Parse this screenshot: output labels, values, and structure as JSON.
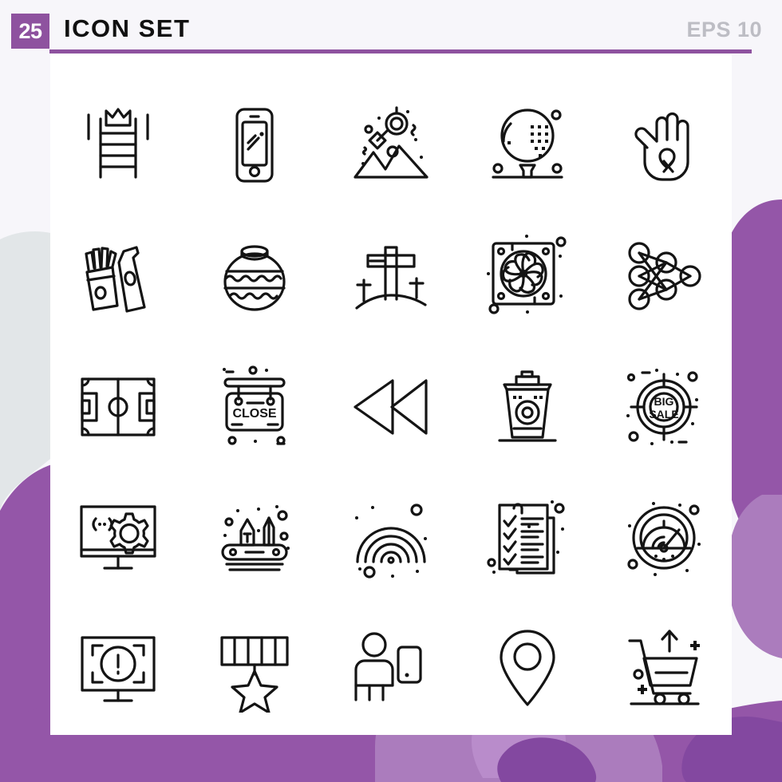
{
  "header": {
    "count_badge": "25",
    "title": "ICON SET",
    "format_label": "EPS 10"
  },
  "colors": {
    "accent_purple": "#8e529f",
    "blob_purple": "#9456a8",
    "blob_purple_light": "#ab7cbd",
    "blob_gray": "#e2e6e8",
    "page_background": "#f7f6fa",
    "card_background": "#ffffff",
    "icon_stroke": "#141414",
    "eps_text": "#bdbdc4"
  },
  "grid": {
    "columns": 5,
    "rows": 5,
    "total": 25
  },
  "icons": [
    {
      "index": 1,
      "name": "ladder-crown-icon",
      "label": "Ladder with crown"
    },
    {
      "index": 2,
      "name": "smartphone-icon",
      "label": "Smartphone"
    },
    {
      "index": 3,
      "name": "satellite-mountains-icon",
      "label": "Satellite over mountains"
    },
    {
      "index": 4,
      "name": "golf-ball-tee-icon",
      "label": "Golf ball on tee"
    },
    {
      "index": 5,
      "name": "hand-ribbon-icon",
      "label": "Hand with awareness ribbon"
    },
    {
      "index": 6,
      "name": "fries-drink-icon",
      "label": "French fries and drink"
    },
    {
      "index": 7,
      "name": "clay-pot-icon",
      "label": "Decorated clay pot"
    },
    {
      "index": 8,
      "name": "calvary-crosses-icon",
      "label": "Crosses on hill"
    },
    {
      "index": 9,
      "name": "cooling-fan-icon",
      "label": "Cooling fan"
    },
    {
      "index": 10,
      "name": "neural-network-icon",
      "label": "Neural network nodes"
    },
    {
      "index": 11,
      "name": "soccer-field-icon",
      "label": "Soccer field"
    },
    {
      "index": 12,
      "name": "close-sign-icon",
      "label": "Close hanging sign",
      "text": "CLOSE"
    },
    {
      "index": 13,
      "name": "rewind-icon",
      "label": "Rewind backward"
    },
    {
      "index": 14,
      "name": "coffee-cup-icon",
      "label": "Coffee cup to go"
    },
    {
      "index": 15,
      "name": "big-sale-target-icon",
      "label": "Big sale target",
      "text_line1": "BIG",
      "text_line2": "SALE"
    },
    {
      "index": 16,
      "name": "web-development-icon",
      "label": "Monitor with code and gear"
    },
    {
      "index": 17,
      "name": "design-tools-icon",
      "label": "Pen and pencil design tools"
    },
    {
      "index": 18,
      "name": "signal-waves-icon",
      "label": "Radar signal waves"
    },
    {
      "index": 19,
      "name": "checklist-icon",
      "label": "Checklist document"
    },
    {
      "index": 20,
      "name": "speedometer-icon",
      "label": "Speedometer gauge"
    },
    {
      "index": 21,
      "name": "alert-monitor-icon",
      "label": "Monitor with alert"
    },
    {
      "index": 22,
      "name": "star-medal-icon",
      "label": "Star medal ribbon"
    },
    {
      "index": 23,
      "name": "user-mobile-icon",
      "label": "Person with mobile device"
    },
    {
      "index": 24,
      "name": "location-pin-icon",
      "label": "Location pin"
    },
    {
      "index": 25,
      "name": "shopping-cart-up-icon",
      "label": "Shopping cart with up arrow"
    }
  ]
}
